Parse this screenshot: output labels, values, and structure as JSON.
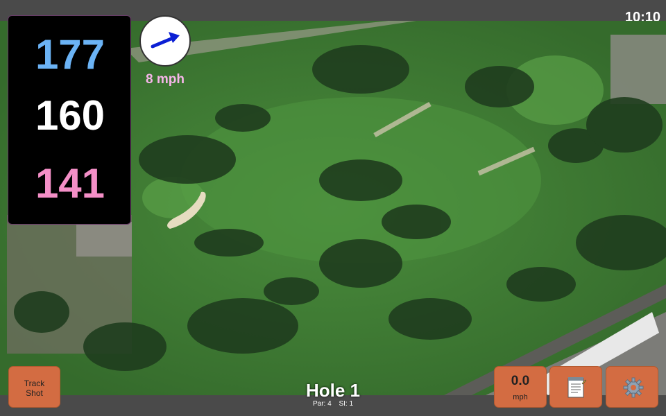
{
  "status": {
    "time": "10:10"
  },
  "yardage": {
    "back": "177",
    "middle": "160",
    "front": "141"
  },
  "wind": {
    "speed": "8 mph",
    "direction_icon": "wind-arrow-icon"
  },
  "buttons": {
    "track_shot": {
      "line1": "Track",
      "line2": "Shot"
    },
    "speed": {
      "value": "0.0",
      "unit": "mph"
    },
    "notes_icon": "notepad-icon",
    "settings_icon": "gear-icon"
  },
  "hole": {
    "title": "Hole 1",
    "par": "Par: 4",
    "si": "SI: 1"
  },
  "colors": {
    "back": "#6bb3f5",
    "middle": "#ffffff",
    "front": "#f48fc7",
    "button": "#d36c42",
    "wind_text": "#f7b6ea"
  }
}
